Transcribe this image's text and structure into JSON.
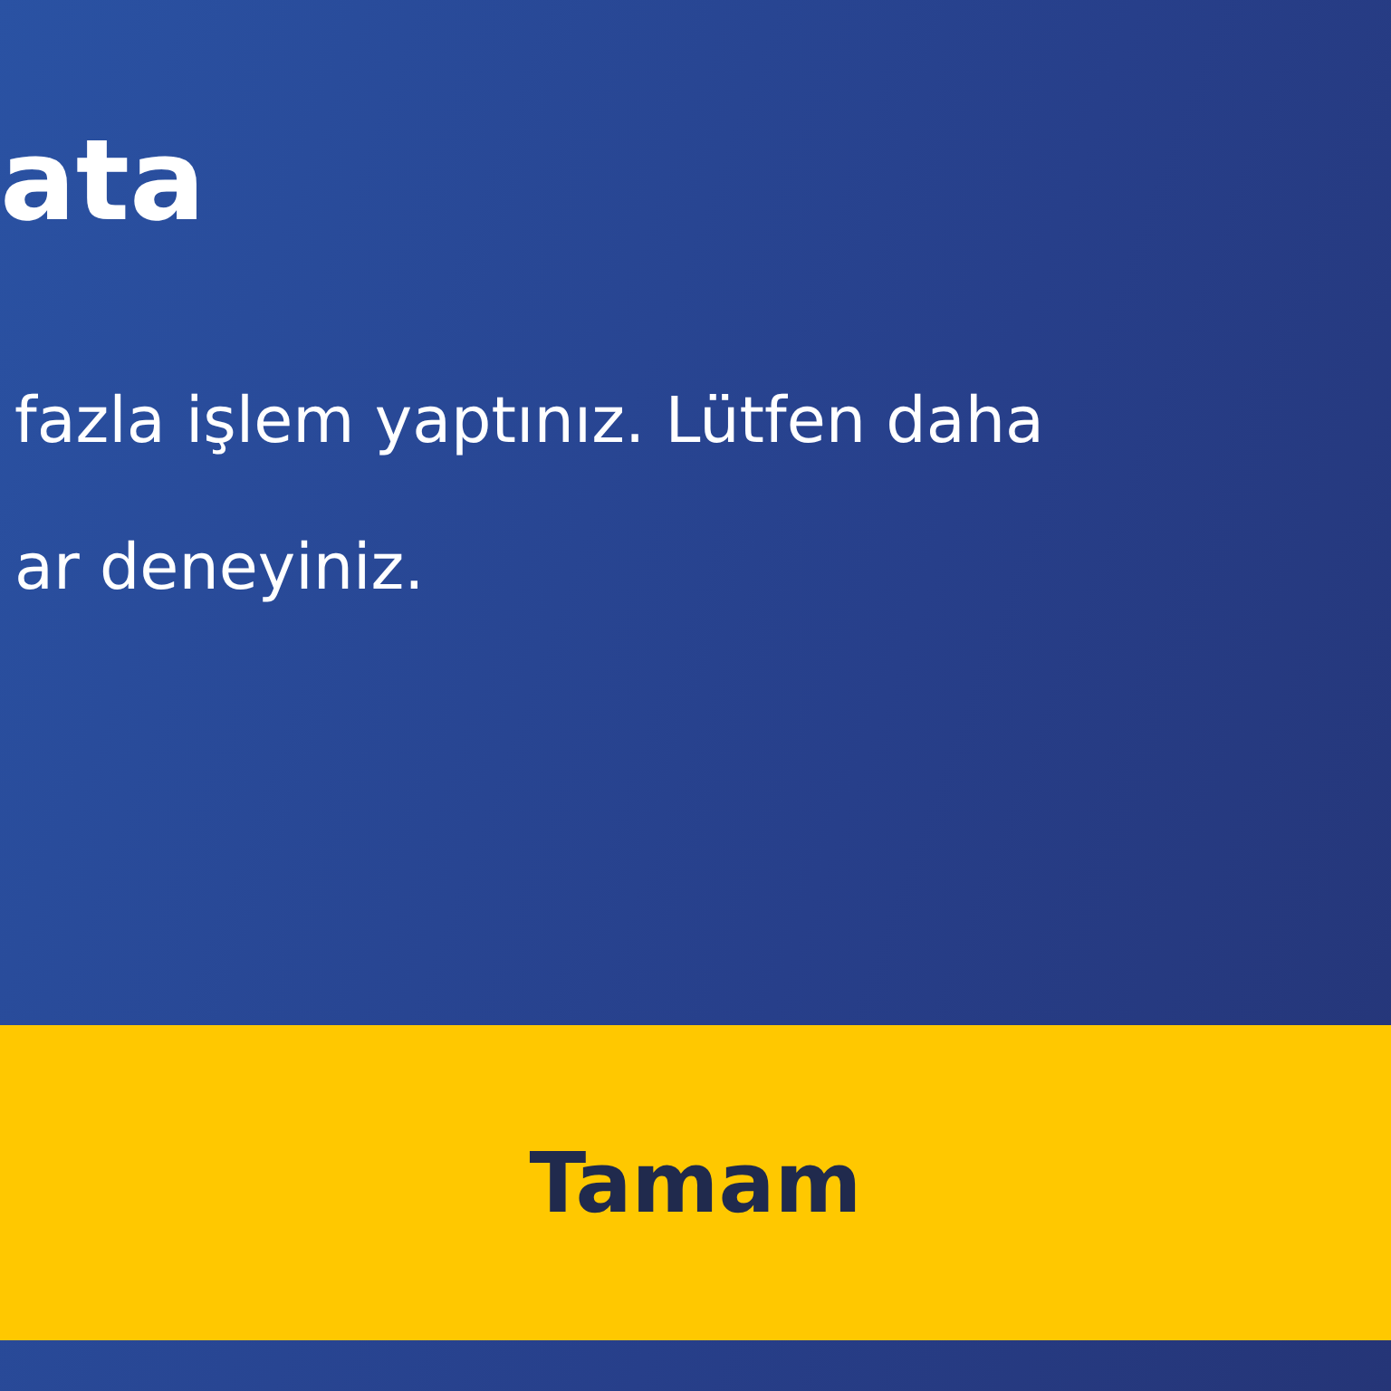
{
  "dialog": {
    "title": "ata",
    "message_lines": [
      "fazla işlem yaptınız. Lütfen daha",
      "ar deneyiniz."
    ],
    "buttons": [
      {
        "label": "Tamam",
        "kind": "primary"
      }
    ]
  }
}
